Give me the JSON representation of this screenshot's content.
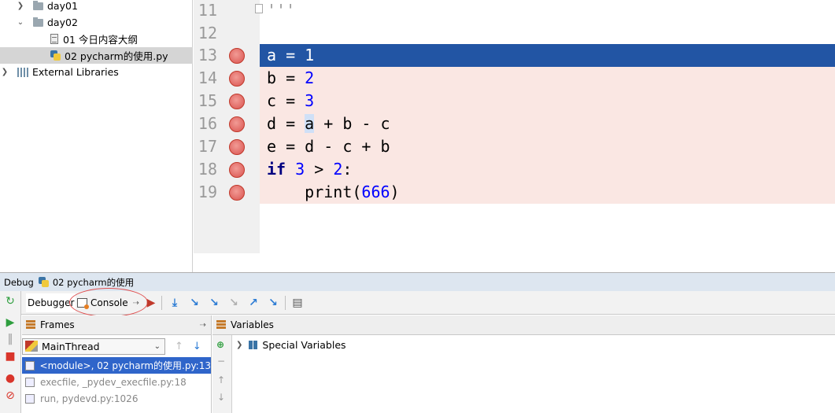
{
  "project_tree": {
    "items": [
      {
        "label": "day01",
        "kind": "folder",
        "expanded": false
      },
      {
        "label": "day02",
        "kind": "folder",
        "expanded": true
      },
      {
        "label": "01 今日内容大纲",
        "kind": "file"
      },
      {
        "label": "02 pycharm的使用.py",
        "kind": "python-file",
        "selected": true
      },
      {
        "label": "External Libraries",
        "kind": "library",
        "expanded": false
      }
    ]
  },
  "editor": {
    "lines": [
      {
        "num": "11",
        "code": "'''"
      },
      {
        "num": "12",
        "code": ""
      },
      {
        "num": "13",
        "code": "a = 1"
      },
      {
        "num": "14",
        "code": "b = 2"
      },
      {
        "num": "15",
        "code": "c = 3"
      },
      {
        "num": "16",
        "code": "d = a + b - c"
      },
      {
        "num": "17",
        "code": "e = d - c + b"
      },
      {
        "num": "18",
        "code": "if 3 > 2:"
      },
      {
        "num": "19",
        "code": "    print(666)"
      }
    ],
    "current_line": "13",
    "breakpoint_lines": [
      "13",
      "14",
      "15",
      "16",
      "17",
      "18",
      "19"
    ]
  },
  "debug": {
    "title": "Debug",
    "config_name": "02 pycharm的使用",
    "tabs": {
      "debugger": "Debugger",
      "console": "Console"
    },
    "frames_title": "Frames",
    "variables_title": "Variables",
    "thread": "MainThread",
    "frames": [
      "<module>, 02 pycharm的使用.py:13",
      "execfile, _pydev_execfile.py:18",
      "run, pydevd.py:1026"
    ],
    "variables": [
      "Special Variables"
    ]
  },
  "colors": {
    "current_line": "#2255a4",
    "breakpoint_line": "#fae7e3",
    "breakpoint": "#d9534f",
    "selected_frame": "#2f65ca",
    "annotation_circle": "#e05050"
  }
}
